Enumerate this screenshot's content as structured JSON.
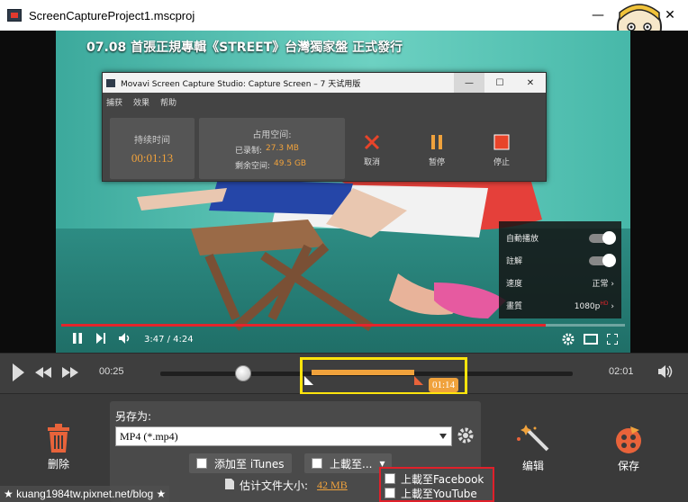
{
  "window": {
    "title": "ScreenCaptureProject1.mscproj",
    "minimize": "—",
    "maximize": "☐",
    "close": "✕"
  },
  "video": {
    "overlay_title": "07.08 首張正規專輯《STREET》台灣獨家盤 正式發行",
    "time": "3:47 / 4:24",
    "progress_fraction": 0.86,
    "settings": [
      {
        "label": "自動播放",
        "value": ""
      },
      {
        "label": "註解",
        "value": ""
      },
      {
        "label": "速度",
        "value": "正常"
      },
      {
        "label": "畫質",
        "value": "1080p"
      }
    ],
    "hd_badge": "HD"
  },
  "capture_dialog": {
    "title": "Movavi Screen Capture Studio: Capture Screen – 7 天试用版",
    "menu": [
      "捕获",
      "效果",
      "帮助"
    ],
    "duration_label": "持续时间",
    "duration_value": "00:01:13",
    "space_label": "占用空间:",
    "recorded_label": "已录制:",
    "recorded_value": "27.3 MB",
    "free_label": "剩余空间:",
    "free_value": "49.5 GB",
    "actions": [
      "取消",
      "暂停",
      "停止"
    ]
  },
  "timeline": {
    "current": "00:25",
    "end": "02:01",
    "knob_fraction": 0.2,
    "selection_badge": "01:14"
  },
  "bottom": {
    "delete_label": "删除",
    "save_as_label": "另存为:",
    "format": "MP4 (*.mp4)",
    "add_itunes": "添加至 iTunes",
    "upload_to": "上載至...",
    "estimate_label": "估计文件大小:",
    "estimate_value": "42 MB",
    "upload_options": [
      "上載至Facebook",
      "上載至YouTube"
    ],
    "edit_label": "编辑",
    "save_label": "保存"
  },
  "watermark": "★ kuang1984tw.pixnet.net/blog ★",
  "colors": {
    "accent_orange": "#f0a23c",
    "highlight_yellow": "#ffe40c",
    "highlight_red": "#e0202a",
    "stop_red": "#e8442a"
  }
}
